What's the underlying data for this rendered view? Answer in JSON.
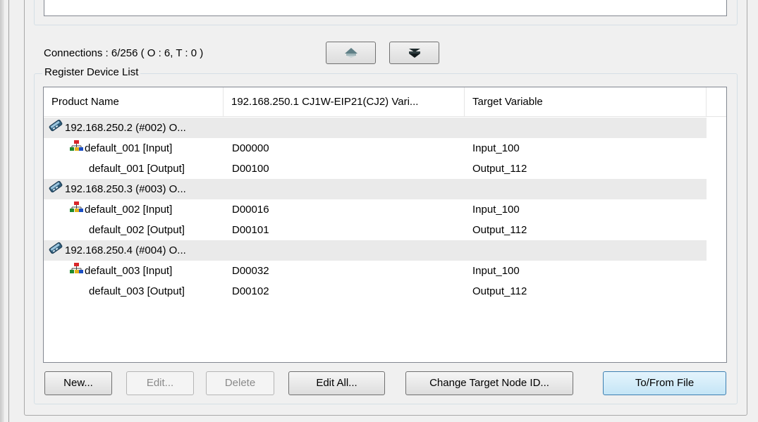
{
  "connections": {
    "text": "Connections :  6/256 ( O : 6, T : 0 )"
  },
  "register_device_list": {
    "legend": "Register Device List",
    "columns": [
      "Product Name",
      "192.168.250.1 CJ1W-EIP21(CJ2) Vari...",
      "Target Variable"
    ],
    "rows": [
      {
        "type": "device",
        "name": "192.168.250.2 (#002) O...",
        "variable": "",
        "target": "",
        "icon": "network-device-icon"
      },
      {
        "type": "tag",
        "name": "default_001 [Input]",
        "variable": "D00000",
        "target": "Input_100",
        "icon": "connection-node-icon"
      },
      {
        "type": "tag",
        "name": "default_001 [Output]",
        "variable": "D00100",
        "target": "Output_112",
        "icon": ""
      },
      {
        "type": "device",
        "name": "192.168.250.3 (#003) O...",
        "variable": "",
        "target": "",
        "icon": "network-device-icon"
      },
      {
        "type": "tag",
        "name": "default_002 [Input]",
        "variable": "D00016",
        "target": "Input_100",
        "icon": "connection-node-icon"
      },
      {
        "type": "tag",
        "name": "default_002 [Output]",
        "variable": "D00101",
        "target": "Output_112",
        "icon": ""
      },
      {
        "type": "device",
        "name": "192.168.250.4 (#004) O...",
        "variable": "",
        "target": "",
        "icon": "network-device-icon"
      },
      {
        "type": "tag",
        "name": "default_003 [Input]",
        "variable": "D00032",
        "target": "Input_100",
        "icon": "connection-node-icon"
      },
      {
        "type": "tag",
        "name": "default_003 [Output]",
        "variable": "D00102",
        "target": "Output_112",
        "icon": ""
      }
    ]
  },
  "buttons": {
    "new": "New...",
    "edit": "Edit...",
    "delete": "Delete",
    "edit_all": "Edit All...",
    "change_target_node_id": "Change Target Node ID...",
    "to_from_file": "To/From File"
  },
  "icons": {
    "move_up": "move-up-icon",
    "move_down": "move-down-icon"
  }
}
